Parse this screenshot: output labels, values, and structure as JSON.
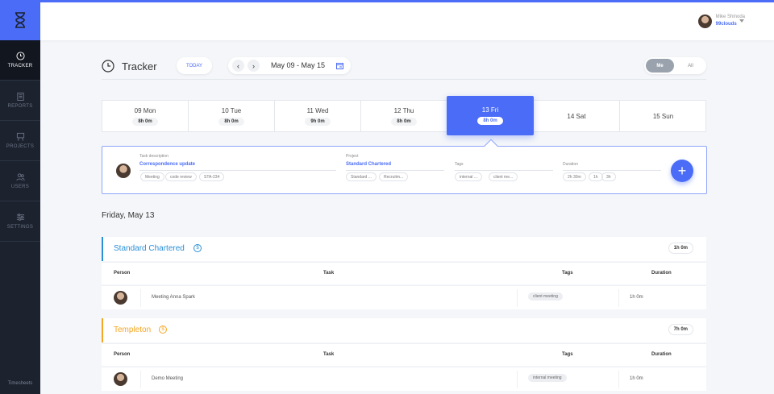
{
  "sidebar": {
    "items": [
      {
        "label": "TRACKER",
        "icon": "clock-icon"
      },
      {
        "label": "REPORTS",
        "icon": "clipboard-icon"
      },
      {
        "label": "PROJECTS",
        "icon": "easel-icon"
      },
      {
        "label": "USERS",
        "icon": "users-icon"
      },
      {
        "label": "SETTINGS",
        "icon": "sliders-icon"
      }
    ],
    "footer": "Timesheets"
  },
  "user": {
    "name": "Mike Shinoda",
    "org": "99clouds"
  },
  "header": {
    "title": "Tracker",
    "today": "TODAY",
    "range": "May 09 - May 15",
    "toggle": {
      "me": "Me",
      "all": "All",
      "selected": "Me"
    }
  },
  "days": [
    {
      "name": "09 Mon",
      "total": "8h 0m"
    },
    {
      "name": "10 Tue",
      "total": "8h 0m"
    },
    {
      "name": "11 Wed",
      "total": "9h 0m"
    },
    {
      "name": "12 Thu",
      "total": "8h 0m"
    },
    {
      "name": "13 Fri",
      "total": "8h 0m"
    },
    {
      "name": "14 Sat",
      "total": ""
    },
    {
      "name": "15 Sun",
      "total": ""
    }
  ],
  "entry": {
    "task_label": "Task description",
    "task_value": "Correspondence update",
    "task_chips": [
      "Meeting",
      "code review",
      "STA-234"
    ],
    "project_label": "Project",
    "project_value": "Standard Chartered",
    "project_chips": [
      "Standard ...",
      "Recruitm..."
    ],
    "tags_label": "Tags",
    "tags_chips": [
      "internal ...",
      "client me..."
    ],
    "duration_label": "Duration",
    "duration_chips": [
      "2h 30m",
      "1h",
      "3h"
    ]
  },
  "date_heading": "Friday, May 13",
  "columns": {
    "person": "Person",
    "task": "Task",
    "tags": "Tags",
    "duration": "Duration"
  },
  "projects": [
    {
      "name": "Standard Chartered",
      "color": "#2a8fd6",
      "total": "1h 0m",
      "rows": [
        {
          "task": "Meeting Anna Spark",
          "tag": "client meeting",
          "duration": "1h 0m"
        }
      ]
    },
    {
      "name": "Templeton",
      "color": "#f5a623",
      "total": "7h 0m",
      "rows": [
        {
          "task": "Demo Meeting",
          "tag": "internal meeting",
          "duration": "1h 0m"
        }
      ]
    }
  ],
  "colors": {
    "accent": "#4a6cf7",
    "sidebar": "#1c222e"
  }
}
